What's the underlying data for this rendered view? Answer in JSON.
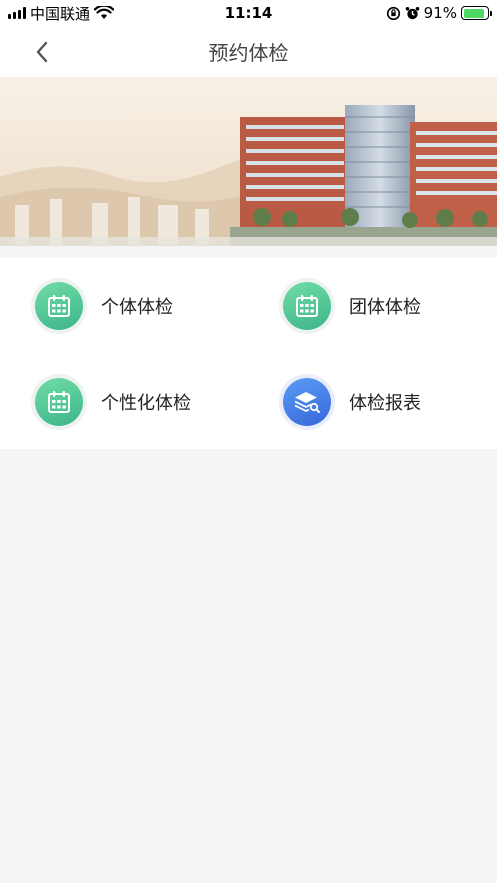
{
  "status_bar": {
    "carrier": "中国联通",
    "time": "11:14",
    "battery_text": "91%",
    "battery_level": 0.91,
    "icons": [
      "signal-icon",
      "wifi-icon",
      "rotation-lock-icon",
      "alarm-icon",
      "battery-icon"
    ]
  },
  "nav": {
    "title": "预约体检",
    "back_icon": "chevron-left-icon"
  },
  "banner": {
    "image": "hospital-building-banner"
  },
  "menu": {
    "items": [
      {
        "label": "个体体检",
        "icon": "calendar-icon",
        "color": "#4cc895"
      },
      {
        "label": "团体体检",
        "icon": "calendar-icon",
        "color": "#4cc895"
      },
      {
        "label": "个性化体检",
        "icon": "calendar-icon",
        "color": "#4cc895"
      },
      {
        "label": "体检报表",
        "icon": "layers-search-icon",
        "color": "#4a80e8"
      }
    ]
  },
  "colors": {
    "page_background": "#f5f5f5",
    "green_accent": "#4cc895",
    "blue_accent": "#4a80e8"
  }
}
